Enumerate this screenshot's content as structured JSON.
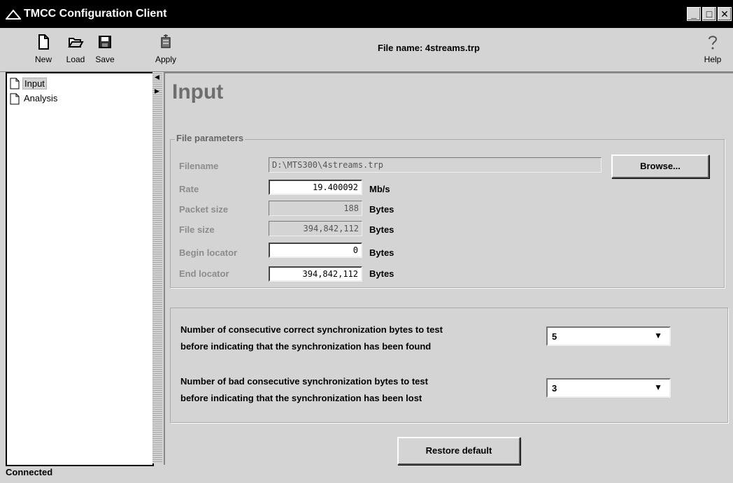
{
  "window": {
    "title": "TMCC Configuration Client"
  },
  "toolbar": {
    "new_label": "New",
    "load_label": "Load",
    "save_label": "Save",
    "apply_label": "Apply",
    "help_label": "Help",
    "file_name": "File name: 4streams.trp"
  },
  "tree": {
    "items": [
      {
        "label": "Input"
      },
      {
        "label": "Analysis"
      }
    ]
  },
  "page": {
    "title": "Input"
  },
  "file_params": {
    "legend": "File parameters",
    "filename_label": "Filename",
    "filename_value": "D:\\MTS300\\4streams.trp",
    "browse_label": "Browse...",
    "rate_label": "Rate",
    "rate_value": "19.400092",
    "rate_unit": "Mb/s",
    "packet_label": "Packet size",
    "packet_value": "188",
    "packet_unit": "Bytes",
    "filesize_label": "File size",
    "filesize_value": "394,842,112",
    "filesize_unit": "Bytes",
    "begin_label": "Begin locator",
    "begin_value": "0",
    "begin_unit": "Bytes",
    "end_label": "End locator",
    "end_value": "394,842,112",
    "end_unit": "Bytes"
  },
  "sync": {
    "found_line1": "Number of consecutive correct synchronization bytes to test",
    "found_line2": "before indicating that the synchronization has been found",
    "found_value": "5",
    "lost_line1": "Number of bad consecutive synchronization bytes to test",
    "lost_line2": "before indicating that the synchronization has been lost",
    "lost_value": "3"
  },
  "restore_label": "Restore default",
  "status": "Connected",
  "colors": {
    "titlebar": "#000000",
    "background": "#d4d4d4"
  }
}
